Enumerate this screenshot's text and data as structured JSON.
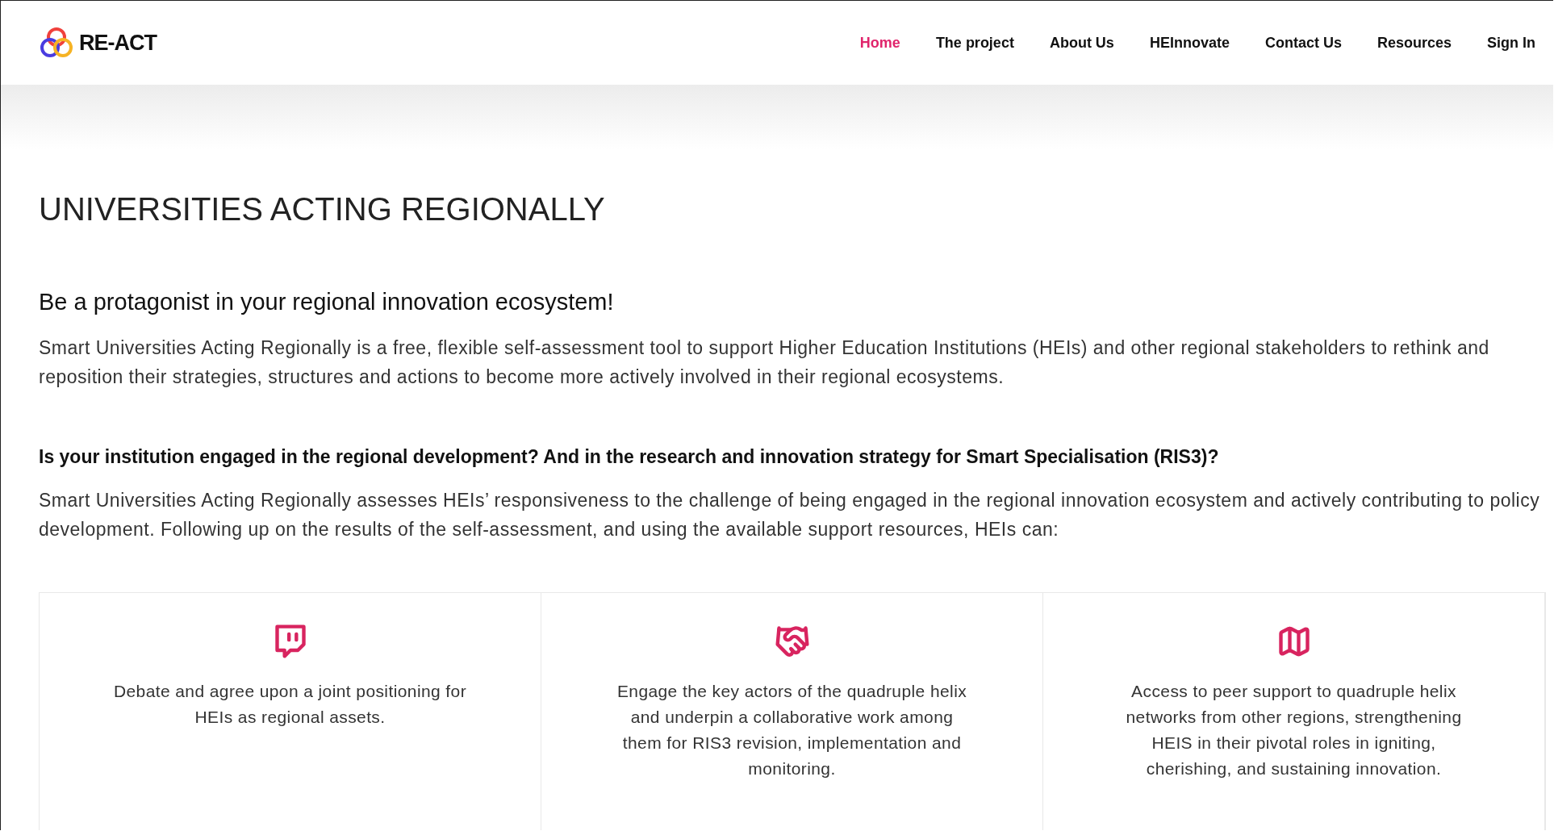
{
  "header": {
    "logo_text": "RE-ACT",
    "nav": [
      {
        "label": "Home",
        "selected": true
      },
      {
        "label": "The project",
        "selected": false
      },
      {
        "label": "About Us",
        "selected": false
      },
      {
        "label": "HEInnovate",
        "selected": false
      },
      {
        "label": "Contact Us",
        "selected": false
      },
      {
        "label": "Resources",
        "selected": false
      },
      {
        "label": "Sign In",
        "selected": false
      }
    ]
  },
  "title": "UNIVERSITIES ACTING REGIONALLY",
  "subtitle": "Be a protagonist in your regional innovation ecosystem!",
  "intro": "Smart Universities Acting Regionally is a free, flexible self-assessment tool to support Higher Education Institutions (HEIs) and other regional stakeholders to rethink and reposition their strategies, structures and actions to become more actively involved in their regional ecosystems.",
  "question": "Is your institution engaged in the regional development? And in the research and innovation strategy for Smart Specialisation (RIS3)?",
  "description": "Smart Universities Acting Regionally assesses HEIs’ responsiveness to the challenge of being engaged in the regional innovation ecosystem and actively contributing to policy development. Following up on the results of the self-assessment, and using the available support resources, HEIs can:",
  "cards": [
    {
      "kind": "chat",
      "text": "Debate and agree upon a joint positioning for HEIs as regional assets."
    },
    {
      "kind": "handshake",
      "text": "Engage the key actors of the quadruple helix and underpin a collaborative work among them for RIS3 revision, implementation and monitoring."
    },
    {
      "kind": "map",
      "text": "Access to peer support to quadruple helix networks from other regions, strengthening HEIS in their pivotal roles in igniting, cherishing, and sustaining innovation."
    }
  ]
}
